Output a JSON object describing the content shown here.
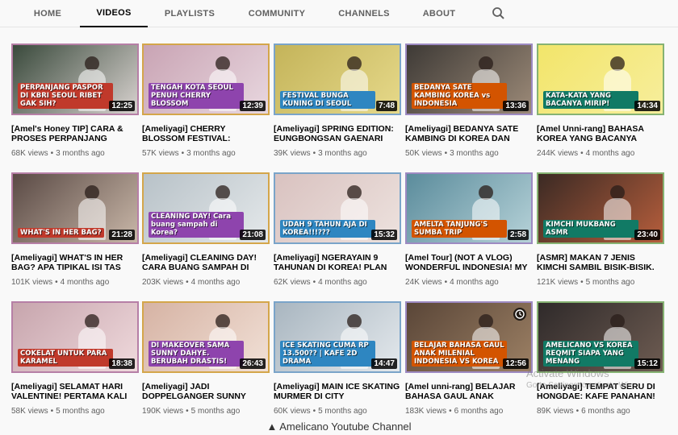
{
  "nav": {
    "tabs": [
      {
        "label": "HOME"
      },
      {
        "label": "VIDEOS"
      },
      {
        "label": "PLAYLISTS"
      },
      {
        "label": "COMMUNITY"
      },
      {
        "label": "CHANNELS"
      },
      {
        "label": "ABOUT"
      }
    ],
    "active": "VIDEOS",
    "search_icon": "search-icon"
  },
  "videos": [
    {
      "title": "[Amel's Honey TIP] CARA & PROSES PERPANJANG",
      "views": "68K views",
      "age": "3 months ago",
      "duration": "12:25",
      "thumb_text": "PERPANJANG PASPOR DI KBRI SEOUL RIBET GAK SIH?",
      "colors": [
        "#3a4a3c",
        "#d8d2cf"
      ]
    },
    {
      "title": "[Ameliyagi] CHERRY BLOSSOM FESTIVAL:",
      "views": "57K views",
      "age": "3 months ago",
      "duration": "12:39",
      "thumb_text": "TENGAH KOTA SEOUL PENUH CHERRY BLOSSOM",
      "colors": [
        "#c9a4b4",
        "#e8d7df"
      ]
    },
    {
      "title": "[Ameliyagi] SPRING EDITION: EUNGBONGSAN GAENARI",
      "views": "39K views",
      "age": "3 months ago",
      "duration": "7:48",
      "thumb_text": "FESTIVAL BUNGA KUNING DI SEOUL",
      "colors": [
        "#c4b45a",
        "#e6d98a"
      ]
    },
    {
      "title": "[Ameliyagi] BEDANYA SATE KAMBING DI KOREA DAN",
      "views": "50K views",
      "age": "3 months ago",
      "duration": "13:36",
      "thumb_text": "BEDANYA SATE KAMBING KOREA vs INDONESIA",
      "colors": [
        "#3e3a36",
        "#9c8a78"
      ]
    },
    {
      "title": "[Amel Unni-rang] BAHASA KOREA YANG BACANYA",
      "views": "244K views",
      "age": "4 months ago",
      "duration": "14:34",
      "thumb_text": "KATA-KATA YANG BACANYA MIRIP!",
      "colors": [
        "#f2e56a",
        "#f7ee9c"
      ]
    },
    {
      "title": "[Ameliyagi] WHAT'S IN HER BAG? APA TIPIKAL ISI TAS",
      "views": "101K views",
      "age": "4 months ago",
      "duration": "21:28",
      "thumb_text": "WHAT'S IN HER BAG?",
      "colors": [
        "#5a4a45",
        "#c9b7a8"
      ]
    },
    {
      "title": "[Ameliyagi] CLEANING DAY! CARA BUANG SAMPAH DI",
      "views": "203K views",
      "age": "4 months ago",
      "duration": "21:08",
      "thumb_text": "CLEANING DAY! Cara buang sampah di Korea?",
      "colors": [
        "#b8c2c8",
        "#e4e8ea"
      ]
    },
    {
      "title": "[Ameliyagi] NGERAYAIN 9 TAHUNAN DI KOREA! PLAN",
      "views": "62K views",
      "age": "4 months ago",
      "duration": "15:32",
      "thumb_text": "UDAH 9 TAHUN AJA DI KOREA!!!???",
      "colors": [
        "#d9c2c0",
        "#ede2de"
      ]
    },
    {
      "title": "[Amel Tour] (NOT A VLOG) WONDERFUL INDONESIA! MY",
      "views": "24K views",
      "age": "4 months ago",
      "duration": "2:58",
      "thumb_text": "AMELTA TANJUNG'S SUMBA TRIP",
      "colors": [
        "#5b8c9c",
        "#b6d2d8"
      ]
    },
    {
      "title": "[ASMR] MAKAN 7 JENIS KIMCHI SAMBIL BISIK-BISIK.",
      "views": "121K views",
      "age": "5 months ago",
      "duration": "23:40",
      "thumb_text": "KIMCHI MUKBANG ASMR",
      "colors": [
        "#3b2a24",
        "#b65e3c"
      ]
    },
    {
      "title": "[Ameliyagi] SELAMAT HARI VALENTINE! PERTAMA KALI",
      "views": "58K views",
      "age": "5 months ago",
      "duration": "18:38",
      "thumb_text": "COKELAT UNTUK PARA KARAMEL",
      "colors": [
        "#c7a5ad",
        "#efd9dc"
      ]
    },
    {
      "title": "[Ameliyagi] JADI DOPPELGANGER SUNNY",
      "views": "190K views",
      "age": "5 months ago",
      "duration": "26:43",
      "thumb_text": "DI MAKEOVER SAMA SUNNY DAHYE. BERUBAH DRASTIS!",
      "colors": [
        "#d6b3a4",
        "#f1e0d6"
      ]
    },
    {
      "title": "[Ameliyagi] MAIN ICE SKATING MURMER DI CITY",
      "views": "60K views",
      "age": "5 months ago",
      "duration": "14:47",
      "thumb_text": "ICE SKATING CUMA RP 13.500?? | KAFE 2D DRAMA",
      "colors": [
        "#a9b6c0",
        "#e3e8ec"
      ]
    },
    {
      "title": "[Amel unni-rang] BELAJAR BAHASA GAUL ANAK",
      "views": "183K views",
      "age": "6 months ago",
      "duration": "12:56",
      "thumb_text": "BELAJAR BAHASA GAUL ANAK MILENIAL INDONESIA VS KOREA",
      "colors": [
        "#5a4638",
        "#9c8064"
      ]
    },
    {
      "title": "[Ameliyagi] TEMPAT SERU DI HONGDAE: KAFE PANAHAN!",
      "views": "89K views",
      "age": "6 months ago",
      "duration": "15:12",
      "thumb_text": "AMELICANO VS KOREA REQMIT SIAPA YANG MENANG",
      "colors": [
        "#2f2a2a",
        "#6e5c52"
      ]
    }
  ],
  "watermark": {
    "line1": "Activate Windows",
    "line2": "Go to Settings to activate Wi"
  },
  "caption": "▲ Amelicano Youtube Channel"
}
